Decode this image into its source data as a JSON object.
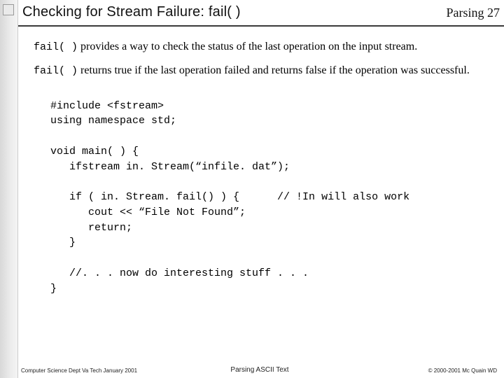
{
  "header": {
    "title": "Checking for Stream Failure:  fail( )",
    "section": "Parsing",
    "page": "27"
  },
  "body": {
    "code_fail": "fail( )",
    "para1_rest": " provides a way to check the status of the last operation on the input stream.",
    "para2_rest": " returns true if the last operation failed and returns false if the operation was successful.",
    "code_block": "#include <fstream>\nusing namespace std;\n\nvoid main( ) {\n   ifstream in. Stream(“infile. dat”);\n\n   if ( in. Stream. fail() ) {      // !In will also work\n      cout << “File Not Found”;\n      return;\n   }\n\n   //. . . now do interesting stuff . . .\n}"
  },
  "footer": {
    "left": "Computer Science Dept Va Tech January 2001",
    "center": "Parsing ASCII Text",
    "right": "© 2000-2001  Mc Quain WD"
  }
}
